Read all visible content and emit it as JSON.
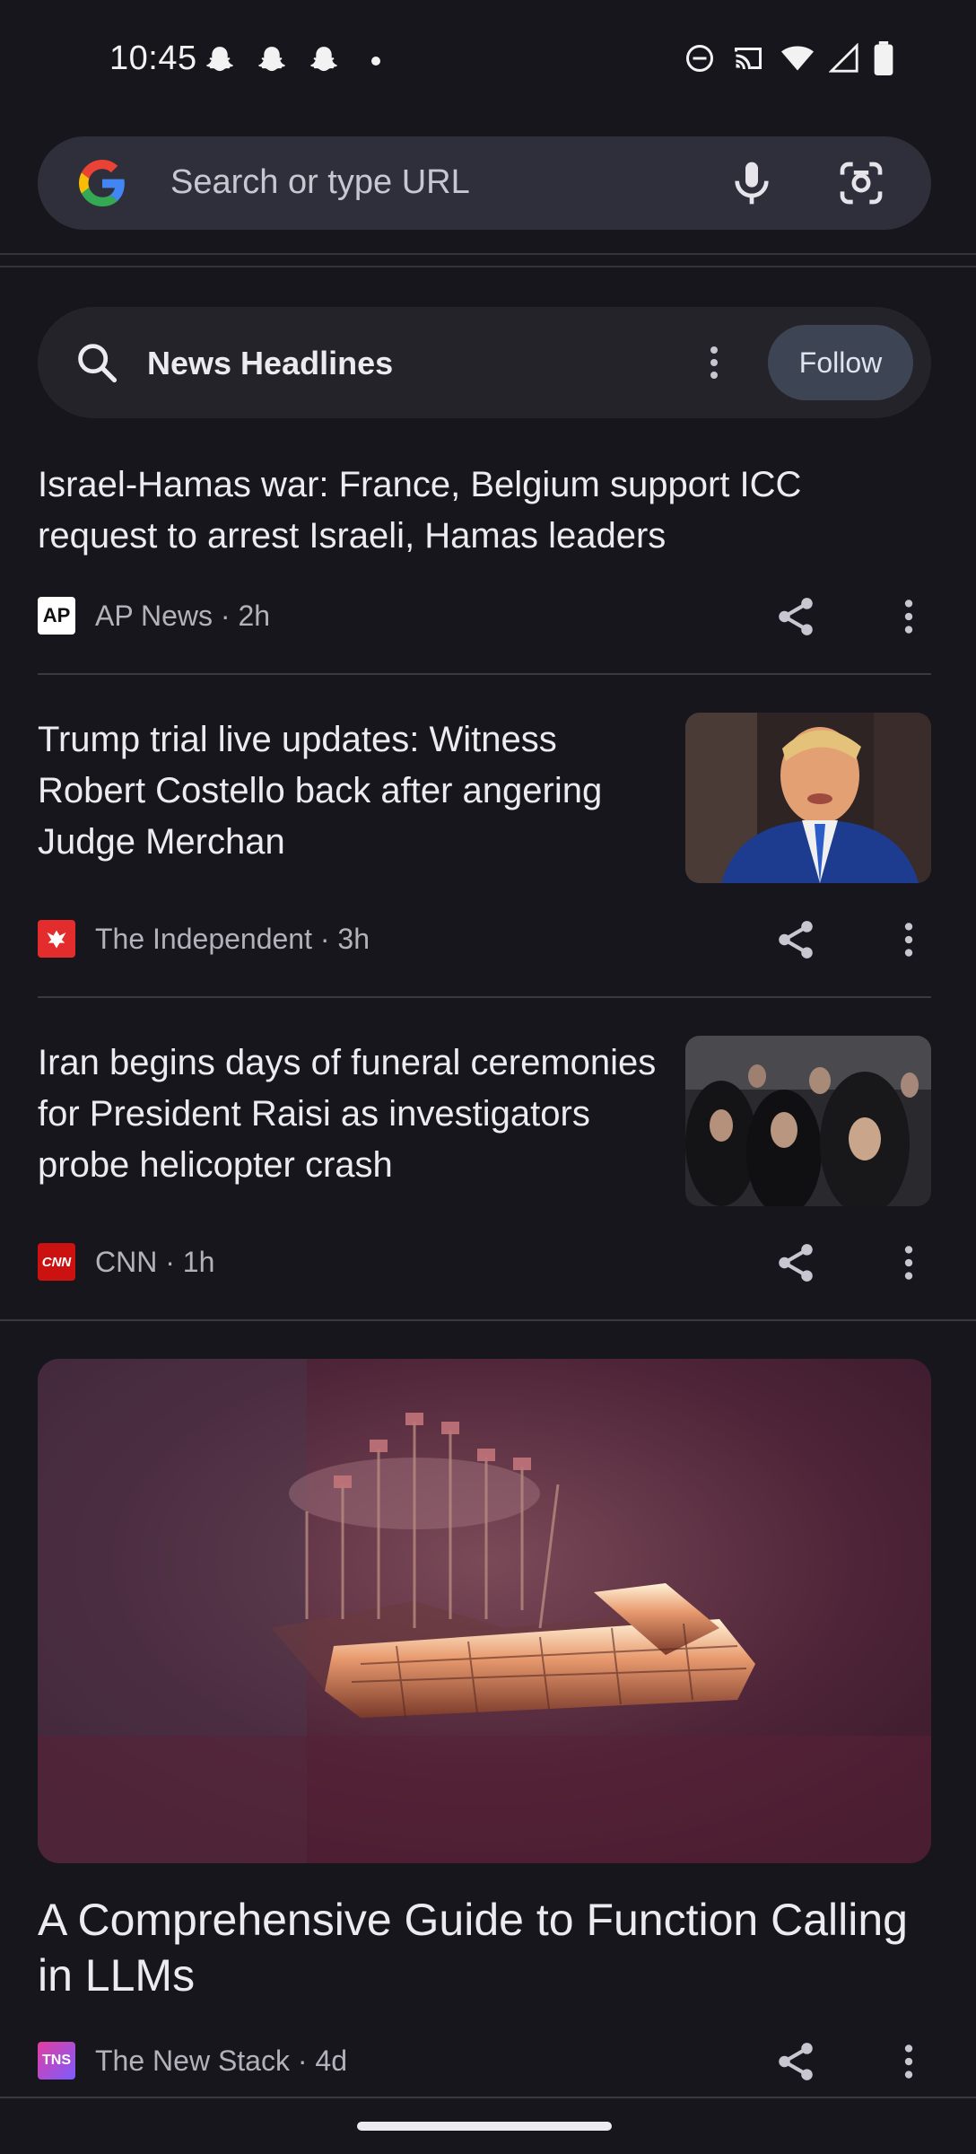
{
  "status_bar": {
    "time": "10:45"
  },
  "search": {
    "placeholder": "Search or type URL"
  },
  "topic": {
    "title": "News Headlines",
    "follow_label": "Follow"
  },
  "articles": [
    {
      "title": "Israel-Hamas war: France, Belgium support ICC request to arrest Israeli, Hamas leaders",
      "source": "AP News · 2h",
      "logo": "AP"
    },
    {
      "title": "Trump trial live updates: Witness Robert Costello back after angering Judge Merchan",
      "source": "The Independent · 3h",
      "logo": ""
    },
    {
      "title": "Iran begins days of funeral ceremonies for President Raisi as investigators probe helicopter crash",
      "source": "CNN · 1h",
      "logo": "CNN"
    },
    {
      "title": "A Comprehensive Guide to Function Calling in LLMs",
      "source": "The New Stack · 4d",
      "logo": "TNS"
    }
  ],
  "colors": {
    "background": "#17161c",
    "search_bar": "#2f2e3b",
    "follow_button": "#3d4554"
  }
}
